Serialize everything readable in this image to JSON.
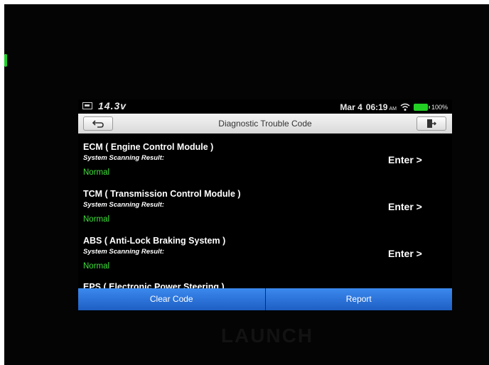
{
  "device": {
    "logo_text": "LAUNCH"
  },
  "status_bar": {
    "voltage": "14.3v",
    "date": "Mar 4",
    "time": "06:19",
    "ampm": "AM",
    "battery_percent": "100%",
    "battery_color": "#22d024"
  },
  "title_bar": {
    "title": "Diagnostic Trouble Code",
    "back_icon": "back-arrow-icon",
    "exit_icon": "exit-door-icon"
  },
  "modules": [
    {
      "name": "ECM ( Engine Control Module )",
      "scan_label": "System Scanning Result:",
      "result": "Normal",
      "enter_label": "Enter >"
    },
    {
      "name": "TCM ( Transmission Control Module )",
      "scan_label": "System Scanning Result:",
      "result": "Normal",
      "enter_label": "Enter >"
    },
    {
      "name": "ABS ( Anti-Lock Braking System )",
      "scan_label": "System Scanning Result:",
      "result": "Normal",
      "enter_label": "Enter >"
    }
  ],
  "partial_module": {
    "name": "EPS ( Electronic Power Steering )"
  },
  "bottom_bar": {
    "clear_code_label": "Clear Code",
    "report_label": "Report",
    "button_color": "#2f78e0"
  },
  "colors": {
    "normal_result": "#3fe03b",
    "screen_bg": "#000000"
  }
}
